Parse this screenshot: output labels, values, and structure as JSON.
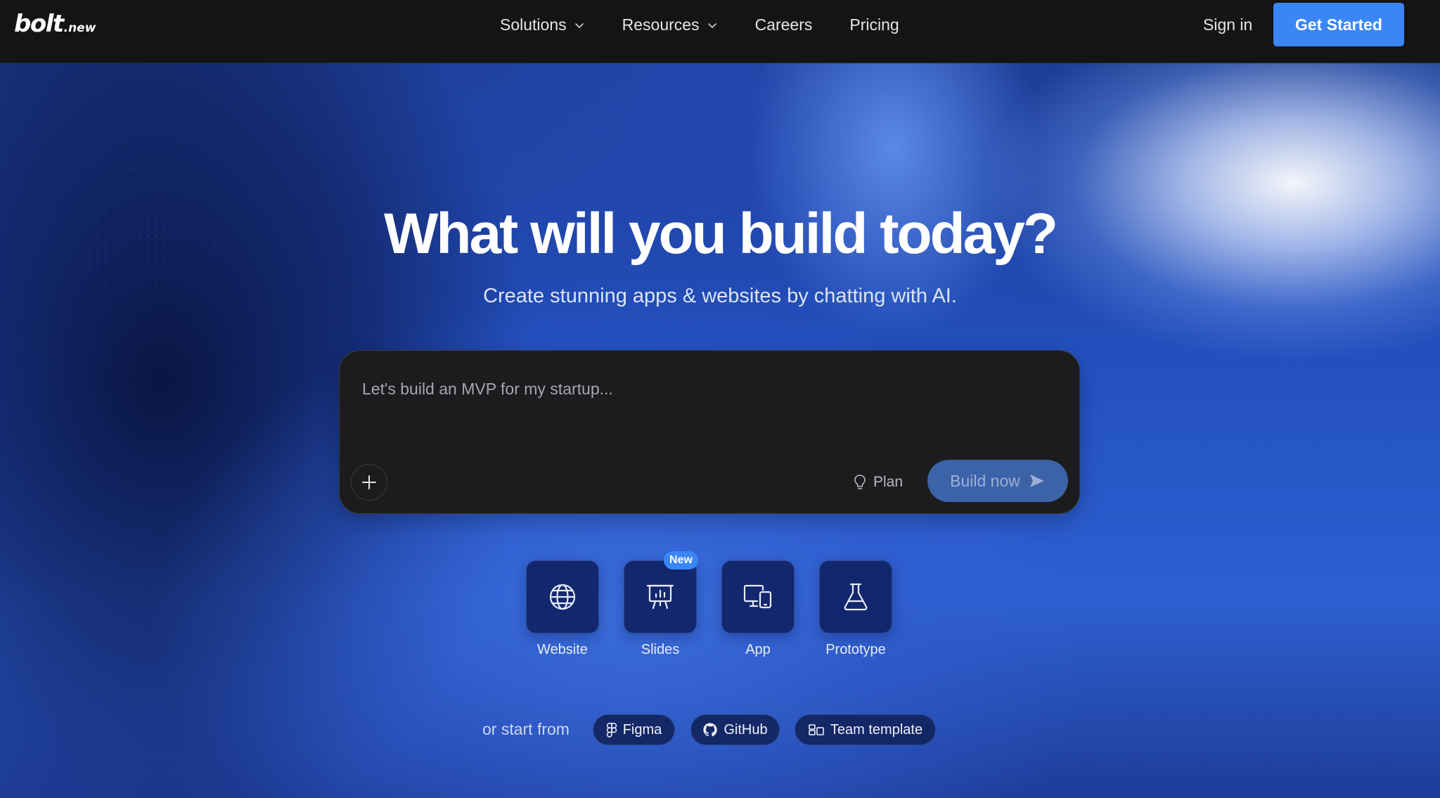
{
  "header": {
    "logo_main": "bolt",
    "logo_sub": ".new",
    "nav": [
      {
        "label": "Solutions",
        "dropdown": true
      },
      {
        "label": "Resources",
        "dropdown": true
      },
      {
        "label": "Careers",
        "dropdown": false
      },
      {
        "label": "Pricing",
        "dropdown": false
      }
    ],
    "sign_in": "Sign in",
    "get_started": "Get Started"
  },
  "hero": {
    "title": "What will you build today?",
    "subtitle": "Create stunning apps & websites by chatting with AI."
  },
  "prompt": {
    "placeholder": "Let's build an MVP for my startup...",
    "value": "",
    "add_icon": "plus-icon",
    "plan_label": "Plan",
    "plan_icon": "lightbulb-icon",
    "build_label": "Build now",
    "build_icon": "send-arrow-icon"
  },
  "categories": [
    {
      "label": "Website",
      "icon": "globe-icon",
      "badge": ""
    },
    {
      "label": "Slides",
      "icon": "presentation-chart-icon",
      "badge": "New"
    },
    {
      "label": "App",
      "icon": "devices-icon",
      "badge": ""
    },
    {
      "label": "Prototype",
      "icon": "flask-icon",
      "badge": ""
    }
  ],
  "start_from": {
    "label": "or start from",
    "options": [
      {
        "label": "Figma",
        "icon": "figma-icon"
      },
      {
        "label": "GitHub",
        "icon": "github-icon"
      },
      {
        "label": "Team template",
        "icon": "template-icon"
      }
    ]
  },
  "colors": {
    "header_bg": "#141416",
    "accent": "#3b86f6",
    "prompt_bg": "#1c1c1f",
    "build_button_bg": "#3c63a8",
    "tile_bg": "#0f2264"
  }
}
